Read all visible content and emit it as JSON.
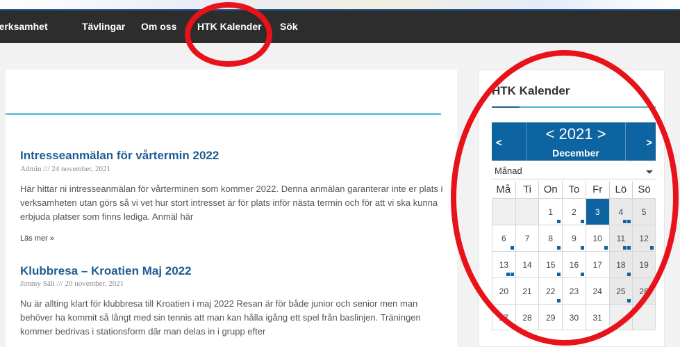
{
  "nav": {
    "items": [
      {
        "label": "Verksamhet"
      },
      {
        "label": "Tävlingar"
      },
      {
        "label": "Om oss"
      },
      {
        "label": "HTK Kalender"
      },
      {
        "label": "Sök"
      }
    ]
  },
  "posts": [
    {
      "title": "Intresseanmälan för vårtermin 2022",
      "meta": "Admin /// 24 november, 2021",
      "excerpt": "Här hittar ni intresseanmälan för vårterminen som kommer 2022. Denna anmälan garanterar inte er plats i verksamheten utan görs så vi vet hur stort intresset är för plats inför nästa termin och för att vi ska kunna erbjuda platser som finns lediga.  Anmäl här",
      "read_more": "Läs mer »"
    },
    {
      "title": "Klubbresa – Kroatien Maj 2022",
      "meta": "Jimmy Säll /// 20 november, 2021",
      "excerpt": "Nu är allting klart för klubbresa till Kroatien i maj 2022 Resan är för både junior och senior men man behöver ha kommit så långt med sin tennis att man kan hålla igång ett spel från baslinjen. Träningen kommer bedrivas i stationsform där man delas in i grupp efter"
    }
  ],
  "sidebar": {
    "title": "HTK Kalender",
    "calendar": {
      "prev": "<",
      "next": ">",
      "year_label": "< 2021 >",
      "month": "December",
      "view_select": "Månad",
      "weekdays": [
        "Må",
        "Ti",
        "On",
        "To",
        "Fr",
        "Lö",
        "Sö"
      ],
      "weeks": [
        [
          "",
          "",
          "1",
          "2",
          "3",
          "4",
          "5"
        ],
        [
          "6",
          "7",
          "8",
          "9",
          "10",
          "11",
          "12"
        ],
        [
          "13",
          "14",
          "15",
          "16",
          "17",
          "18",
          "19"
        ],
        [
          "20",
          "21",
          "22",
          "23",
          "24",
          "25",
          "26"
        ],
        [
          "27",
          "28",
          "29",
          "30",
          "31",
          "",
          ""
        ]
      ]
    }
  },
  "colors": {
    "accent": "#0d64a0",
    "link": "#1e5d94",
    "annotation": "#e8121b"
  }
}
